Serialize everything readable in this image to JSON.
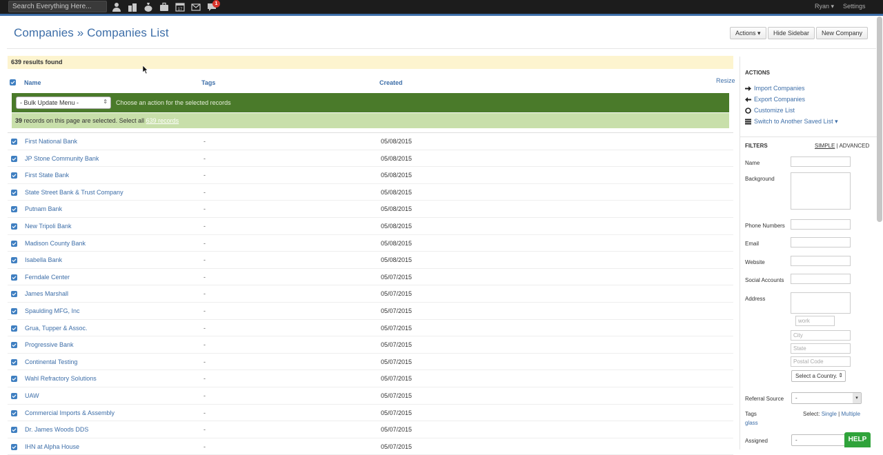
{
  "topbar": {
    "search_placeholder": "Search Everything Here...",
    "icons": [
      "person-icon",
      "buildings-icon",
      "money-bag-icon",
      "briefcase-icon",
      "calendar-icon",
      "mail-icon",
      "chat-icon"
    ],
    "calendar_day": "17",
    "notification_count": "1",
    "user": "Ryan ▾",
    "settings": "Settings"
  },
  "header": {
    "title": "Companies » Companies List",
    "actions_label": "Actions ▾",
    "hide_sidebar_label": "Hide Sidebar",
    "new_company_label": "New Company"
  },
  "results": {
    "text": "639 results found"
  },
  "table": {
    "columns": {
      "name": "Name",
      "tags": "Tags",
      "created": "Created"
    },
    "resize": "Resize",
    "bulk_menu": "- Bulk Update Menu -",
    "bulk_hint": "Choose an action for the selected records",
    "selected_prefix": "39",
    "selected_text": " records on this page are selected. Select all ",
    "select_all_link": "639 records",
    "rows": [
      {
        "name": "First National Bank",
        "tags": "-",
        "created": "05/08/2015"
      },
      {
        "name": "JP Stone Community Bank",
        "tags": "-",
        "created": "05/08/2015"
      },
      {
        "name": "First State Bank",
        "tags": "-",
        "created": "05/08/2015"
      },
      {
        "name": "State Street Bank & Trust Company",
        "tags": "-",
        "created": "05/08/2015"
      },
      {
        "name": "Putnam Bank",
        "tags": "-",
        "created": "05/08/2015"
      },
      {
        "name": "New Tripoli Bank",
        "tags": "-",
        "created": "05/08/2015"
      },
      {
        "name": "Madison County Bank",
        "tags": "-",
        "created": "05/08/2015"
      },
      {
        "name": "Isabella Bank",
        "tags": "-",
        "created": "05/08/2015"
      },
      {
        "name": "Ferndale Center",
        "tags": "-",
        "created": "05/07/2015"
      },
      {
        "name": "James Marshall",
        "tags": "-",
        "created": "05/07/2015"
      },
      {
        "name": "Spaulding MFG, Inc",
        "tags": "-",
        "created": "05/07/2015"
      },
      {
        "name": "Grua, Tupper & Assoc.",
        "tags": "-",
        "created": "05/07/2015"
      },
      {
        "name": "Progressive Bank",
        "tags": "-",
        "created": "05/07/2015"
      },
      {
        "name": "Continental Testing",
        "tags": "-",
        "created": "05/07/2015"
      },
      {
        "name": "Wahl Refractory Solutions",
        "tags": "-",
        "created": "05/07/2015"
      },
      {
        "name": "UAW",
        "tags": "-",
        "created": "05/07/2015"
      },
      {
        "name": "Commercial Imports & Assembly",
        "tags": "-",
        "created": "05/07/2015"
      },
      {
        "name": "Dr. James Woods DDS",
        "tags": "-",
        "created": "05/07/2015"
      },
      {
        "name": "IHN at Alpha House",
        "tags": "-",
        "created": "05/07/2015"
      }
    ]
  },
  "sidebar": {
    "actions_heading": "ACTIONS",
    "actions": {
      "import": "Import Companies",
      "export": "Export Companies",
      "customize": "Customize List",
      "switch": "Switch to Another Saved List ▾"
    },
    "filters_heading": "FILTERS",
    "mode_simple": "SIMPLE",
    "mode_sep": " | ",
    "mode_advanced": "ADVANCED",
    "labels": {
      "name": "Name",
      "background": "Background",
      "phone": "Phone Numbers",
      "email": "Email",
      "website": "Website",
      "social": "Social Accounts",
      "address": "Address",
      "referral": "Referral Source",
      "tags": "Tags",
      "assigned": "Assigned"
    },
    "address_type_placeholder": "work",
    "city_placeholder": "City",
    "state_placeholder": "State",
    "postal_placeholder": "Postal Code",
    "country_select": "Select a Country.",
    "referral_value": "-",
    "assigned_value": "-",
    "tags_select_label": "Select:",
    "tags_single": "Single",
    "tags_sep": " | ",
    "tags_multiple": "Multiple",
    "tags_value": "glass"
  },
  "help": "HELP",
  "colors": {
    "brand_blue": "#3d6ea8",
    "bulk_green": "#4a7a2a",
    "selected_green": "#c8dfaa",
    "results_yellow": "#fdf4cf",
    "help_green": "#2fa33a"
  }
}
